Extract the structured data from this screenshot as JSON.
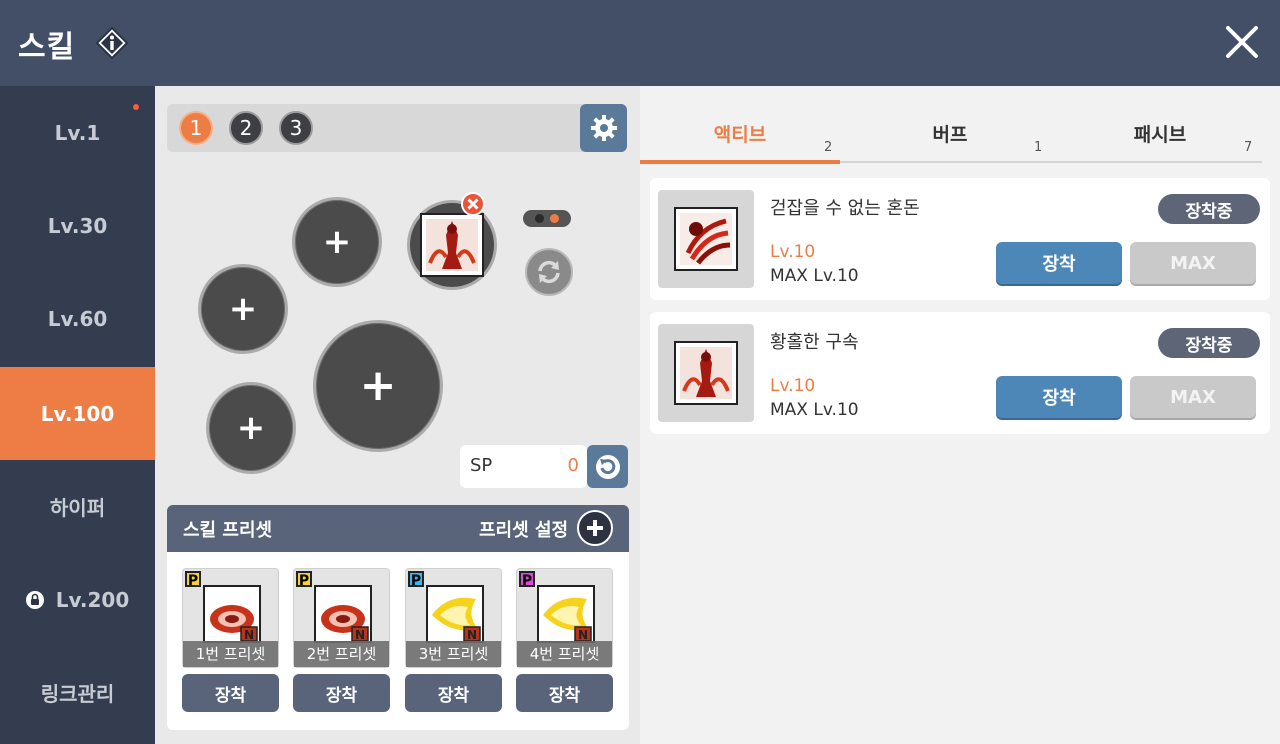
{
  "header": {
    "title": "스킬"
  },
  "sidebar": {
    "items": [
      {
        "label": "Lv.1",
        "has_dot": true
      },
      {
        "label": "Lv.30"
      },
      {
        "label": "Lv.60"
      },
      {
        "label": "Lv.100",
        "active": true
      },
      {
        "label": "하이퍼"
      },
      {
        "label": "Lv.200",
        "locked": true
      },
      {
        "label": "링크관리"
      }
    ]
  },
  "slot_pages": [
    "1",
    "2",
    "3"
  ],
  "active_slot_page": "1",
  "sp": {
    "label": "SP",
    "value": "0"
  },
  "preset_panel": {
    "title": "스킬 프리셋",
    "settings_label": "프리셋 설정",
    "presets": [
      {
        "caption": "1번 프리셋",
        "badge": "P",
        "equip_label": "장착"
      },
      {
        "caption": "2번 프리셋",
        "badge": "P",
        "equip_label": "장착"
      },
      {
        "caption": "3번 프리셋",
        "badge": "P",
        "equip_label": "장착"
      },
      {
        "caption": "4번 프리셋",
        "badge": "P",
        "equip_label": "장착"
      }
    ]
  },
  "tabs": [
    {
      "label": "액티브",
      "count": "2",
      "active": true
    },
    {
      "label": "버프",
      "count": "1"
    },
    {
      "label": "패시브",
      "count": "7"
    }
  ],
  "skills": [
    {
      "name": "걷잡을 수 없는 혼돈",
      "level": "Lv.10",
      "max_level": "MAX Lv.10",
      "status": "장착중",
      "equip_label": "장착",
      "max_label": "MAX"
    },
    {
      "name": "황홀한 구속",
      "level": "Lv.10",
      "max_level": "MAX Lv.10",
      "status": "장착중",
      "equip_label": "장착",
      "max_label": "MAX"
    }
  ],
  "colors": {
    "accent": "#ee7d45",
    "header": "#434f66",
    "sidebar": "#333d4f",
    "button_blue": "#4d87b8"
  }
}
